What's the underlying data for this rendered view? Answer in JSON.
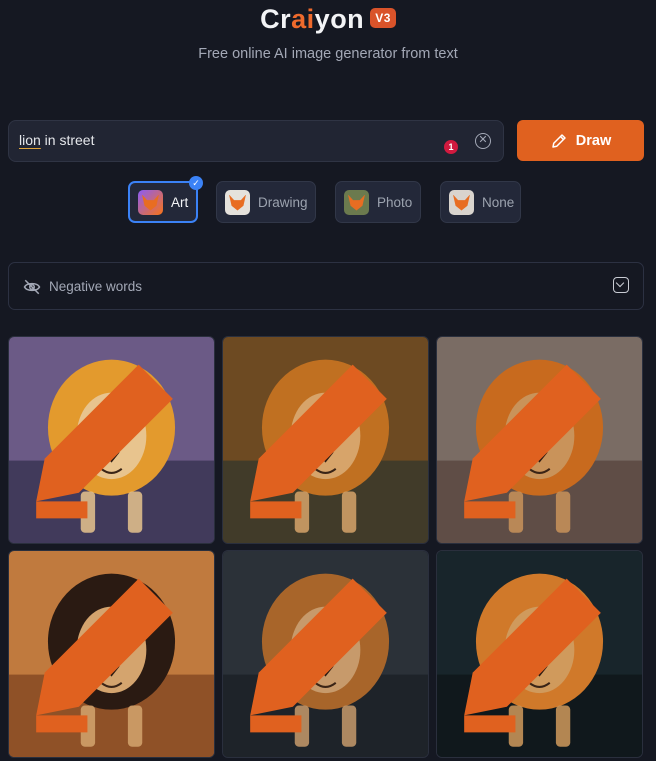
{
  "header": {
    "logo_pre": "Cr",
    "logo_ai": "ai",
    "logo_post": "yon",
    "version_badge": "V3",
    "subtitle": "Free online AI image generator from text"
  },
  "search": {
    "value_word1": "lion",
    "value_rest": " in street",
    "error_count": "1"
  },
  "draw_button": {
    "label": "Draw"
  },
  "styles": [
    {
      "label": "Art",
      "selected": true
    },
    {
      "label": "Drawing",
      "selected": false
    },
    {
      "label": "Photo",
      "selected": false
    },
    {
      "label": "None",
      "selected": false
    }
  ],
  "negative_words": {
    "label": "Negative words"
  },
  "results": [
    {
      "bg_top": "#6b5a86",
      "bg_bottom": "#3d3656",
      "mane": "#e39a2d",
      "face": "#e8c48e"
    },
    {
      "bg_top": "#6d4a22",
      "bg_bottom": "#3c3a2a",
      "mane": "#c07021",
      "face": "#d7a46a"
    },
    {
      "bg_top": "#7a6c64",
      "bg_bottom": "#5c4a42",
      "mane": "#c86a1e",
      "face": "#c9935a"
    },
    {
      "bg_top": "#c07a3e",
      "bg_bottom": "#8a4d25",
      "mane": "#2a1a12",
      "face": "#d4a46e"
    },
    {
      "bg_top": "#2b3138",
      "bg_bottom": "#1d2228",
      "mane": "#a8652a",
      "face": "#c79a6b"
    },
    {
      "bg_top": "#18252b",
      "bg_bottom": "#0f171b",
      "mane": "#d0792a",
      "face": "#d09a5c"
    }
  ],
  "colors": {
    "accent": "#e0611f",
    "selected_border": "#3b82f6",
    "background": "#151822"
  },
  "icons": {
    "draw": "pencil-icon",
    "clear": "clear-circle-icon",
    "negative": "eye-off-icon",
    "expand": "chevron-down-icon",
    "edit": "pencil-edit-icon"
  }
}
